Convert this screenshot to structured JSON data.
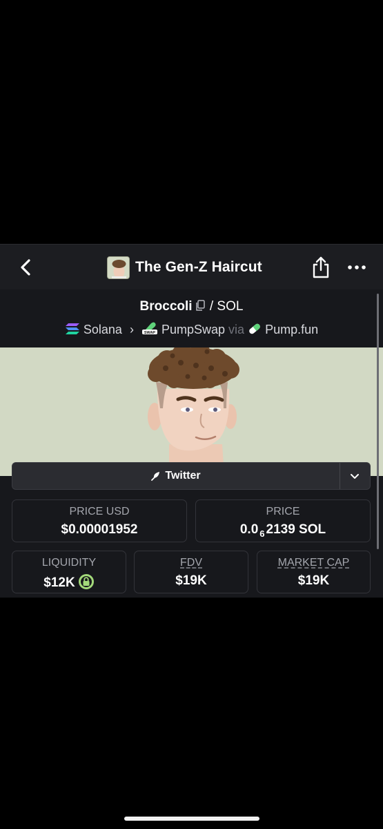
{
  "header": {
    "title": "The Gen-Z Haircut",
    "back_icon": "chevron-left-icon",
    "share_icon": "share-icon",
    "more_icon": "more-dots-icon"
  },
  "pair": {
    "base": "Broccoli",
    "separator": "/",
    "quote": "SOL",
    "chain": "Solana",
    "dex": "PumpSwap",
    "via_label": "via",
    "launchpad": "Pump.fun"
  },
  "links": {
    "twitter_label": "Twitter"
  },
  "stats": {
    "price_usd": {
      "label": "PRICE USD",
      "value": "$0.00001952"
    },
    "price": {
      "label": "PRICE",
      "value_prefix": "0.0",
      "value_zeros": "6",
      "value_suffix": "2139 SOL"
    },
    "liquidity": {
      "label": "LIQUIDITY",
      "value": "$12K"
    },
    "fdv": {
      "label": "FDV",
      "value": "$19K"
    },
    "market_cap": {
      "label": "MARKET CAP",
      "value": "$19K"
    }
  },
  "colors": {
    "background": "#17181c",
    "header": "#1c1d21",
    "card_border": "#33343a",
    "lock_green": "#a3d97a",
    "banner_bg": "#cfd6c0"
  }
}
